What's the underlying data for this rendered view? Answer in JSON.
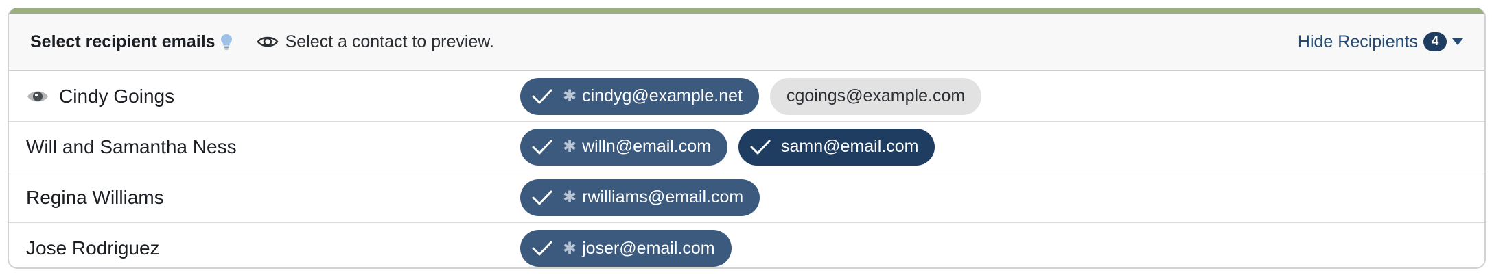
{
  "header": {
    "title": "Select recipient emails",
    "preview_text": "Select a contact to preview.",
    "hide_label": "Hide Recipients",
    "count": "4"
  },
  "contacts": [
    {
      "name": "Cindy Goings",
      "previewing": true,
      "emails": [
        {
          "address": "cindyg@example.net",
          "selected": true,
          "primary": true
        },
        {
          "address": "cgoings@example.com",
          "selected": false,
          "primary": false
        }
      ]
    },
    {
      "name": "Will and Samantha Ness",
      "previewing": false,
      "emails": [
        {
          "address": "willn@email.com",
          "selected": true,
          "primary": true
        },
        {
          "address": "samn@email.com",
          "selected": true,
          "primary": false
        }
      ]
    },
    {
      "name": "Regina Williams",
      "previewing": false,
      "emails": [
        {
          "address": "rwilliams@email.com",
          "selected": true,
          "primary": true
        }
      ]
    },
    {
      "name": "Jose Rodriguez",
      "previewing": false,
      "emails": [
        {
          "address": "joser@email.com",
          "selected": true,
          "primary": true
        }
      ]
    }
  ],
  "colors": {
    "accent_bar": "#9cb07f",
    "selected_pill": "#3c5a7e",
    "selected_pill_dark": "#1f3d60",
    "unselected_pill": "#e2e2e2",
    "link": "#254a73"
  },
  "icons": {
    "hint": "lightbulb-icon",
    "preview": "eye-icon",
    "selected": "checkmark-icon",
    "primary": "asterisk-icon",
    "expand": "caret-down-icon"
  }
}
